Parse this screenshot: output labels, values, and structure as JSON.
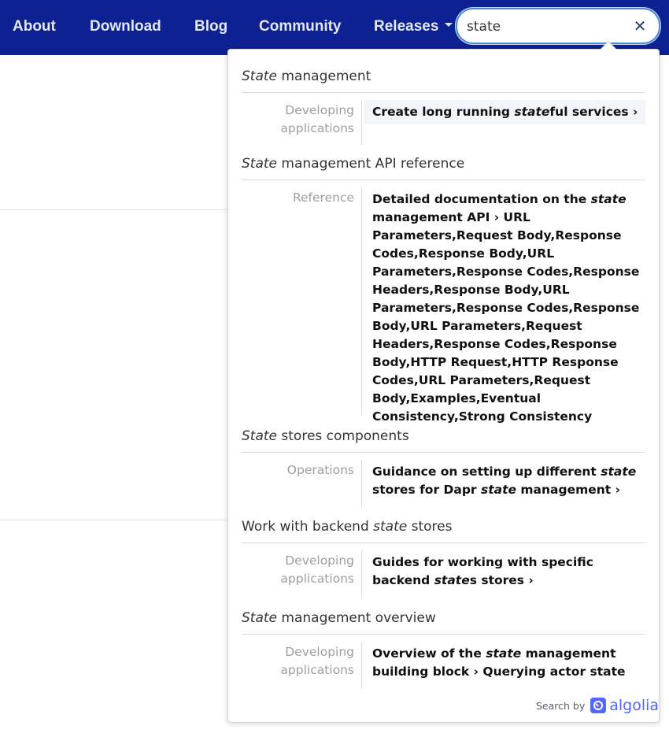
{
  "nav": {
    "items": [
      "About",
      "Download",
      "Blog",
      "Community"
    ],
    "releases_label": "Releases"
  },
  "search": {
    "value": "state",
    "clear_glyph": "✕"
  },
  "results": [
    {
      "title_pre": "",
      "title_em": "State",
      "title_post": " management",
      "category": "Developing applications",
      "content_pre": "Create long running ",
      "content_em": "state",
      "content_post": "ful services ›"
    },
    {
      "title_pre": "",
      "title_em": "State",
      "title_post": " management API reference",
      "category": "Reference",
      "content_pre": "Detailed documentation on the ",
      "content_em": "state",
      "content_post": " management API › URL Parameters,Request Body,Response Codes,Response Body,URL Parameters,Response Codes,Response Headers,Response Body,URL Parameters,Response Codes,Response Body,URL Parameters,Request Headers,Response Codes,Response Body,HTTP Request,HTTP Response Codes,URL Parameters,Request Body,Examples,Eventual Consistency,Strong Consistency"
    },
    {
      "title_pre": "",
      "title_em": "State",
      "title_post": " stores components",
      "category": "Operations",
      "content_pre": "Guidance on setting up different ",
      "content_em": "state",
      "content_mid": " stores for Dapr ",
      "content_em2": "state",
      "content_post": " management ›"
    },
    {
      "title_pre": "Work with backend ",
      "title_em": "state",
      "title_post": " stores",
      "category": "Developing applications",
      "content_pre": "Guides for working with specific backend ",
      "content_em": "state",
      "content_post": "s stores ›"
    },
    {
      "title_pre": "",
      "title_em": "State",
      "title_post": " management overview",
      "category": "Developing applications",
      "content_pre": "Overview of the ",
      "content_em": "state",
      "content_post": " management building block › Querying actor state"
    }
  ],
  "footer": {
    "search_by": "Search by",
    "brand": "algolia"
  },
  "colors": {
    "navbar": "#0d2192",
    "brand": "#5468ff",
    "highlight": "#f2f6fb"
  }
}
